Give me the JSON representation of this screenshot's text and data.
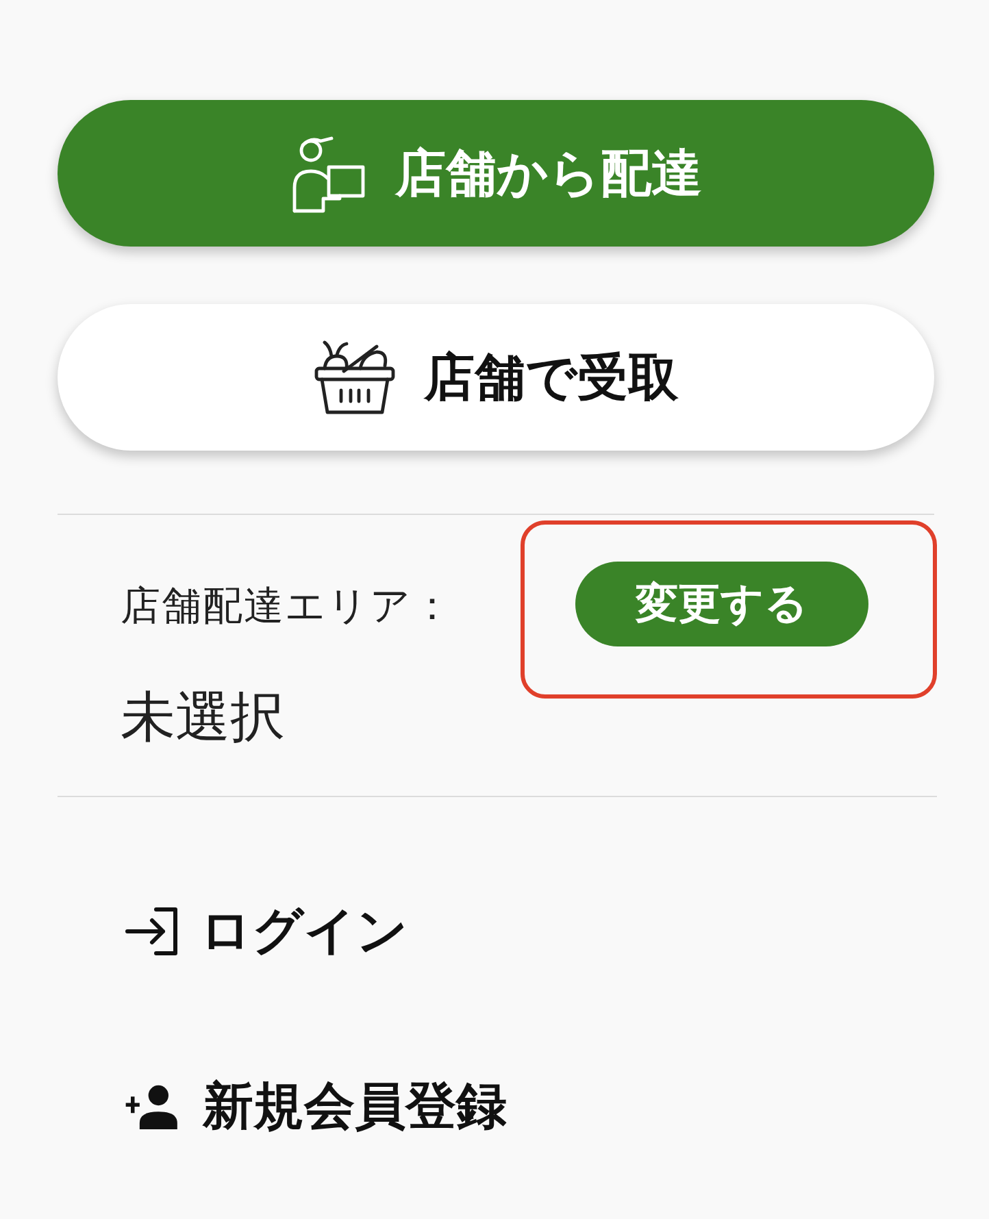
{
  "delivery_options": [
    {
      "kind": "delivery",
      "label": "店舗から配達",
      "selected": true
    },
    {
      "kind": "pickup",
      "label": "店舗で受取",
      "selected": false
    }
  ],
  "area": {
    "label": "店舗配達エリア：",
    "value": "未選択",
    "change_button": "変更する",
    "highlighted": true
  },
  "menu": [
    {
      "kind": "login",
      "label": "ログイン"
    },
    {
      "kind": "signup",
      "label": "新規会員登録"
    }
  ]
}
